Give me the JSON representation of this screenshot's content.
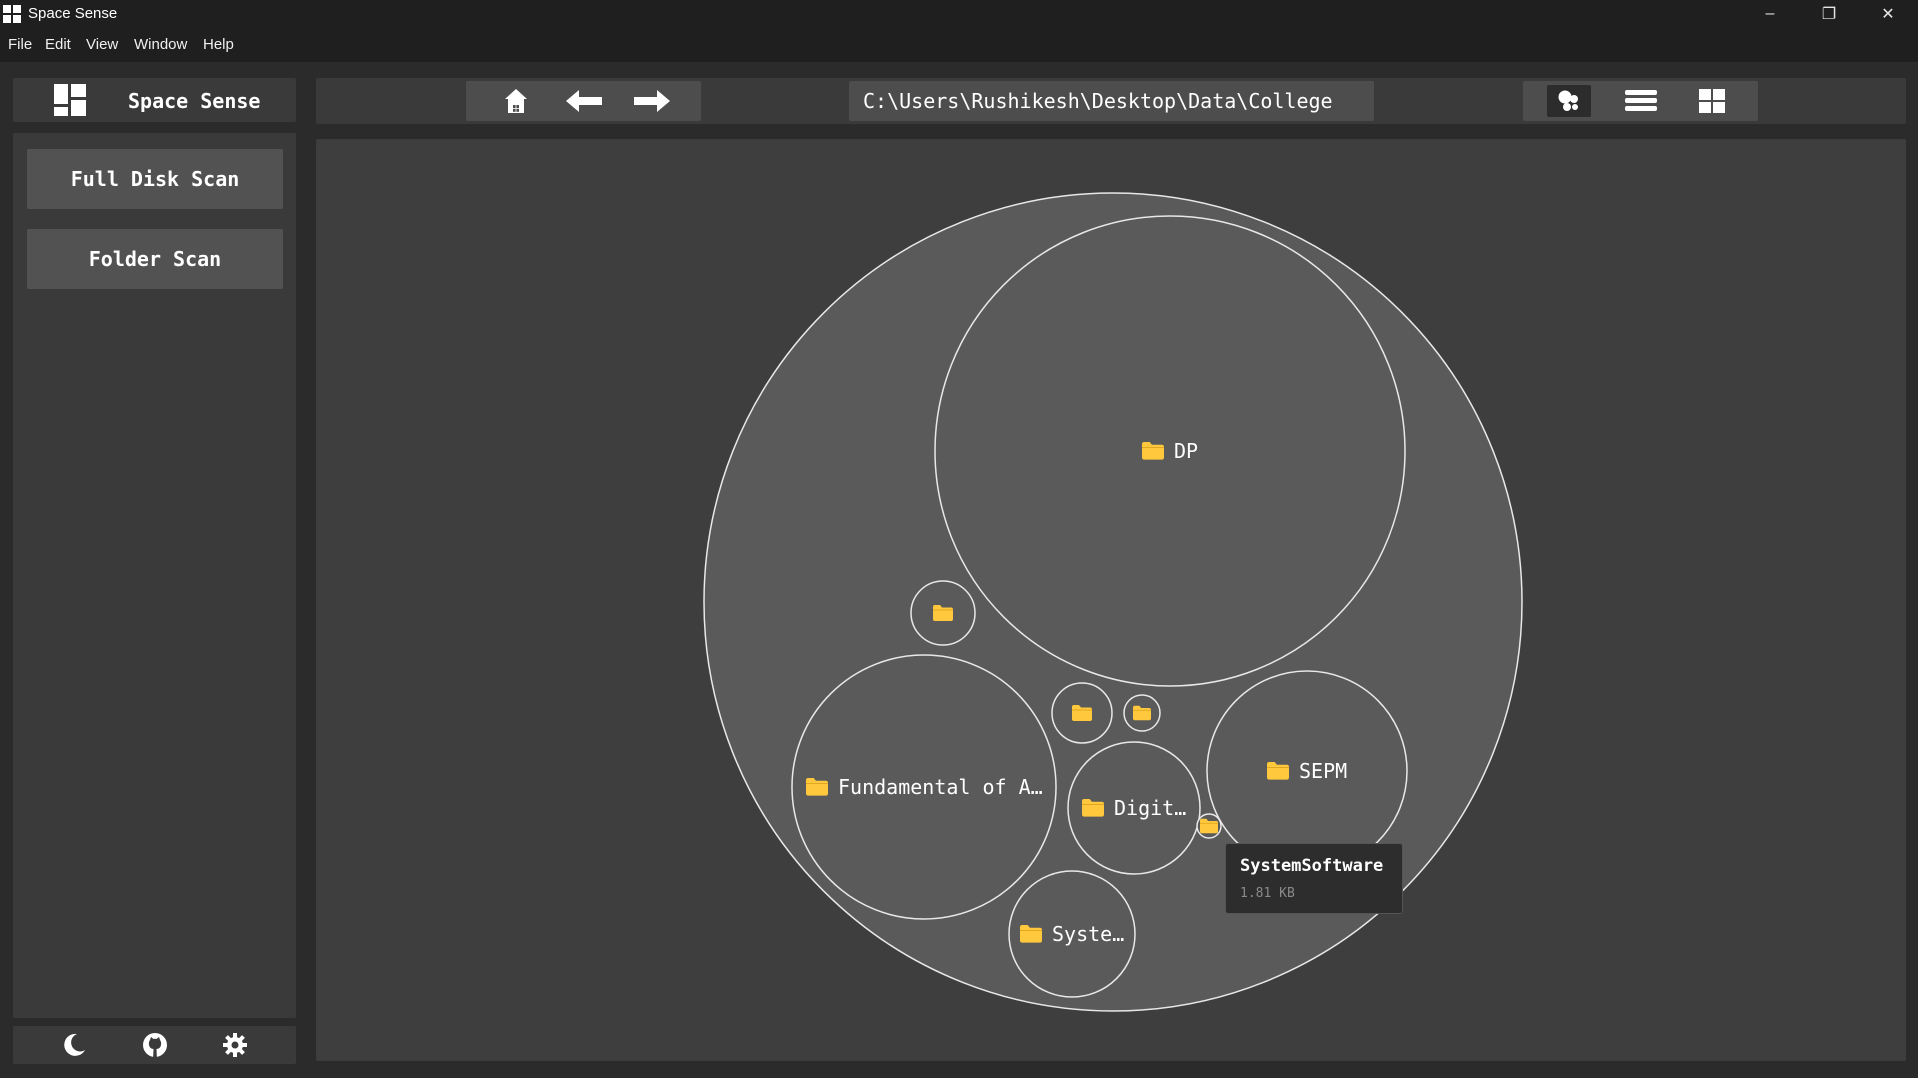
{
  "window": {
    "title": "Space Sense",
    "controls": [
      "minimize-icon",
      "restore-icon",
      "close-icon"
    ]
  },
  "menu": [
    "File",
    "Edit",
    "View",
    "Window",
    "Help"
  ],
  "sidebar": {
    "app_name": "Space Sense",
    "buttons": [
      "Full Disk Scan",
      "Folder Scan"
    ],
    "footer_icons": [
      "moon-icon",
      "github-icon",
      "gear-icon"
    ]
  },
  "toolbar": {
    "nav_icons": [
      "home-icon",
      "arrow-left-icon",
      "arrow-right-icon"
    ],
    "path": "C:\\Users\\Rushikesh\\Desktop\\Data\\College",
    "view_icons": [
      "bubble-view-icon",
      "list-view-icon",
      "grid-view-icon"
    ],
    "active_view": "bubble"
  },
  "bubbles": [
    {
      "label": "DP"
    },
    {
      "label": "Fundamental of A…"
    },
    {
      "label": "SEPM"
    },
    {
      "label": "Digit…"
    },
    {
      "label": "Syste…"
    },
    {
      "label": ""
    },
    {
      "label": ""
    },
    {
      "label": ""
    },
    {
      "label": ""
    }
  ],
  "tooltip": {
    "name": "SystemSoftware",
    "size": "1.81 KB"
  },
  "colors": {
    "folder": "#ffc83d",
    "bubble_fill": "#5a5a5a",
    "bubble_stroke": "#e8e8e8",
    "panel": "#3a3a3a",
    "button": "#525252"
  }
}
